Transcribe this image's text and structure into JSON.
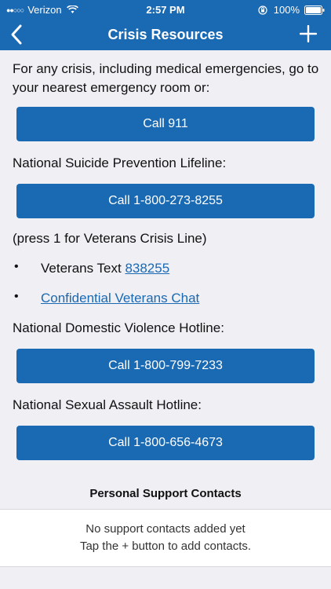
{
  "status_bar": {
    "carrier": "Verizon",
    "time": "2:57 PM",
    "battery": "100%"
  },
  "nav": {
    "title": "Crisis Resources"
  },
  "content": {
    "intro": "For any crisis, including medical emergencies, go to your nearest emergency room or:",
    "call_911": "Call 911",
    "suicide_label": "National Suicide Prevention Lifeline:",
    "suicide_button": "Call 1-800-273-8255",
    "press_note": "(press 1 for Veterans Crisis Line)",
    "bullet_text_prefix": "Veterans Text",
    "bullet_text_link": "838255",
    "chat_link": "Confidential Veterans Chat",
    "dv_label": "National Domestic Violence Hotline:",
    "dv_button": "Call 1-800-799-7233",
    "sa_label": "National Sexual Assault Hotline:",
    "sa_button": "Call 1-800-656-4673"
  },
  "support": {
    "header": "Personal Support Contacts",
    "empty_line1": "No support contacts added yet",
    "empty_line2": "Tap the + button to add contacts."
  },
  "colors": {
    "brand": "#1a69b3",
    "background": "#efeff4"
  }
}
